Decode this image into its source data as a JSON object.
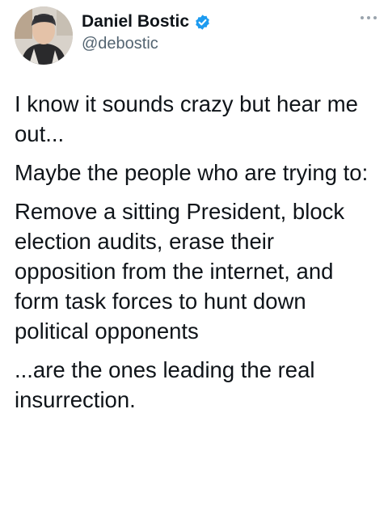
{
  "author": {
    "name": "Daniel Bostic",
    "handle": "@debostic",
    "verified_icon": "verified-badge-icon",
    "verified_color": "#1d9bf0"
  },
  "menu": {
    "icon": "more-options-icon"
  },
  "tweet": {
    "paragraphs": [
      "I know it sounds crazy but hear me out...",
      "Maybe the people who are trying to:",
      "Remove a sitting President, block election audits, erase their opposition from the internet, and form task forces to hunt down political opponents",
      "...are the ones leading the real insurrection."
    ]
  }
}
